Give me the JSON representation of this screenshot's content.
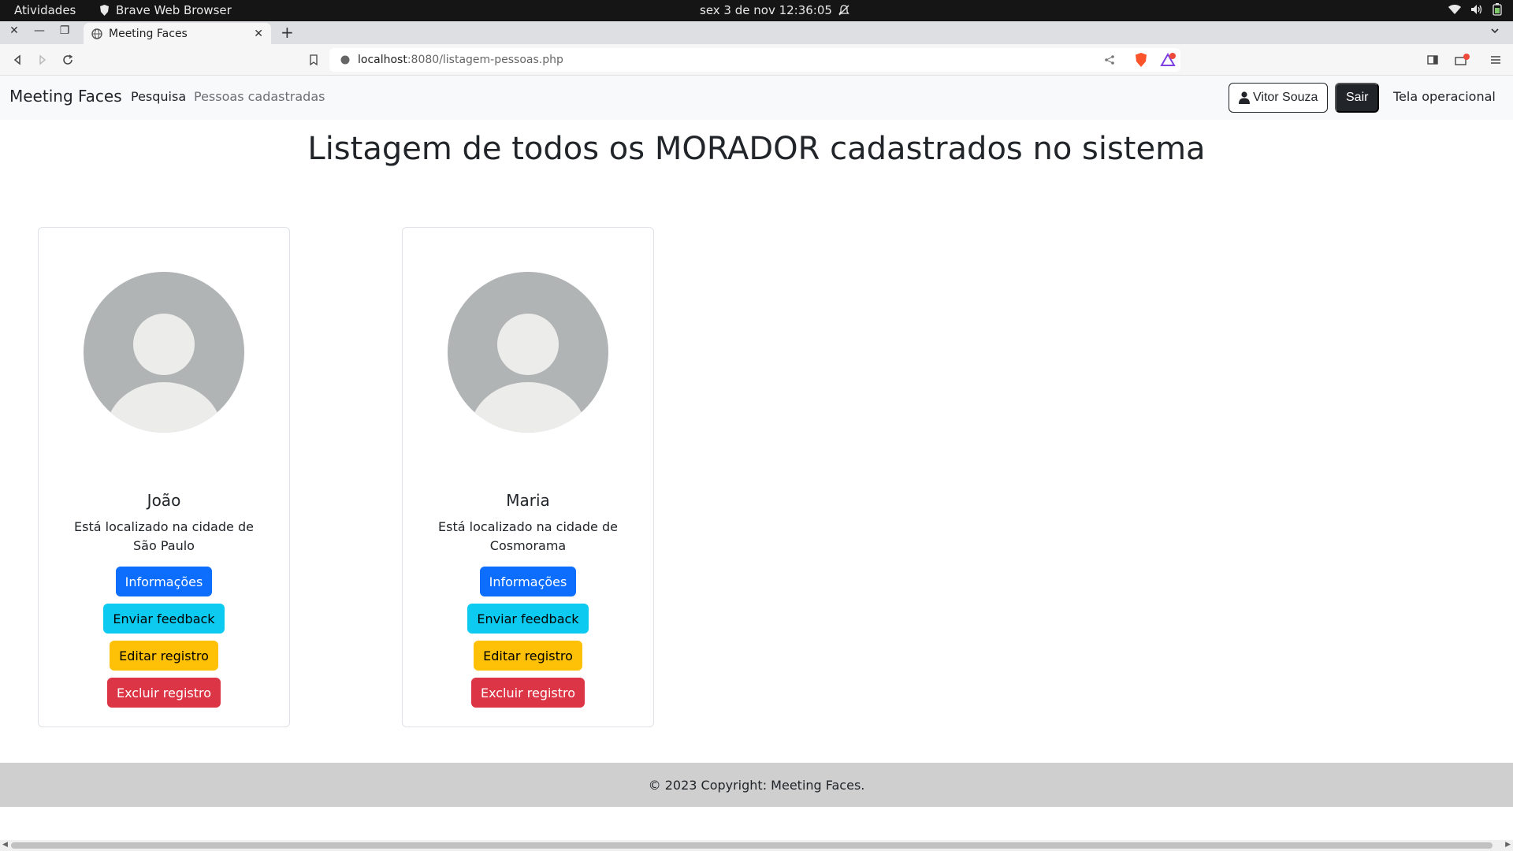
{
  "system": {
    "activities": "Atividades",
    "app_name": "Brave Web Browser",
    "clock": "sex 3 de nov  12:36:05"
  },
  "browser": {
    "tab_title": "Meeting Faces",
    "url_host": "localhost",
    "url_path": ":8080/listagem-pessoas.php"
  },
  "navbar": {
    "brand": "Meeting Faces",
    "links": [
      "Pesquisa",
      "Pessoas cadastradas"
    ],
    "user_button": "Vitor Souza",
    "logout_button": "Sair",
    "operational_link": "Tela operacional"
  },
  "main": {
    "title": "Listagem de todos os MORADOR cadastrados no sistema",
    "cards": [
      {
        "name": "João",
        "text": "Está localizado na cidade de São Paulo",
        "buttons": [
          "Informações",
          "Enviar feedback",
          "Editar registro",
          "Excluir registro"
        ]
      },
      {
        "name": "Maria",
        "text": "Está localizado na cidade de Cosmorama",
        "buttons": [
          "Informações",
          "Enviar feedback",
          "Editar registro",
          "Excluir registro"
        ]
      }
    ]
  },
  "footer": {
    "text": "© 2023 Copyright: Meeting Faces."
  },
  "colors": {
    "primary": "#0d6efd",
    "info": "#0dcaf0",
    "warning": "#ffc107",
    "danger": "#dc3545",
    "dark": "#212529",
    "avatar_bg": "#b1b4b5",
    "avatar_fg": "#ececeb"
  }
}
